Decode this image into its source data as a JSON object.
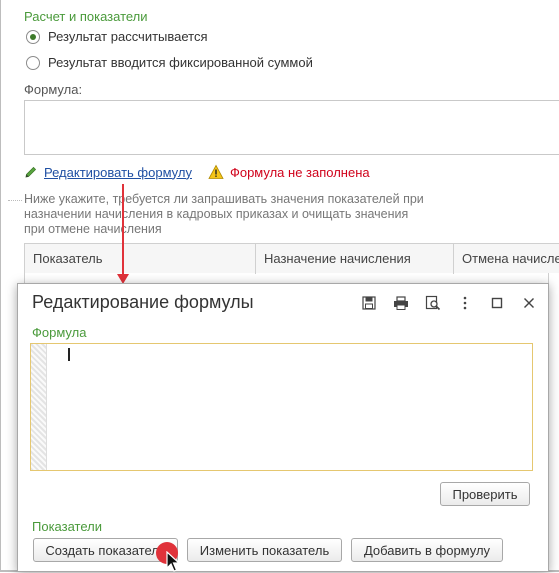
{
  "calc_section": {
    "title": "Расчет и показатели",
    "option_calculated": "Результат рассчитывается",
    "option_fixed": "Результат вводится фиксированной суммой",
    "formula_label": "Формула:",
    "edit_formula_link": "Редактировать формулу",
    "warning_text": "Формула не заполнена",
    "hint_text": "Ниже укажите, требуется ли запрашивать значения показателей при назначении начисления в кадровых приказах и очищать значения при отмене начисления"
  },
  "table": {
    "columns": [
      "Показатель",
      "Назначение начисления",
      "Отмена начисле"
    ]
  },
  "dialog": {
    "title": "Редактирование формулы",
    "formula_label": "Формула",
    "check_button": "Проверить",
    "indicators_label": "Показатели",
    "create_button": "Создать показатель",
    "change_button": "Изменить показатель",
    "add_button": "Добавить в формулу"
  },
  "icons": {
    "save": "save-icon",
    "print": "print-icon",
    "preview": "preview-icon",
    "maximize": "maximize-icon",
    "close": "close-icon"
  },
  "colors": {
    "section_green": "#4a9a3b",
    "link_blue": "#1f4fa3",
    "warning_red": "#d0021b",
    "annotation_red": "#e0323a"
  }
}
